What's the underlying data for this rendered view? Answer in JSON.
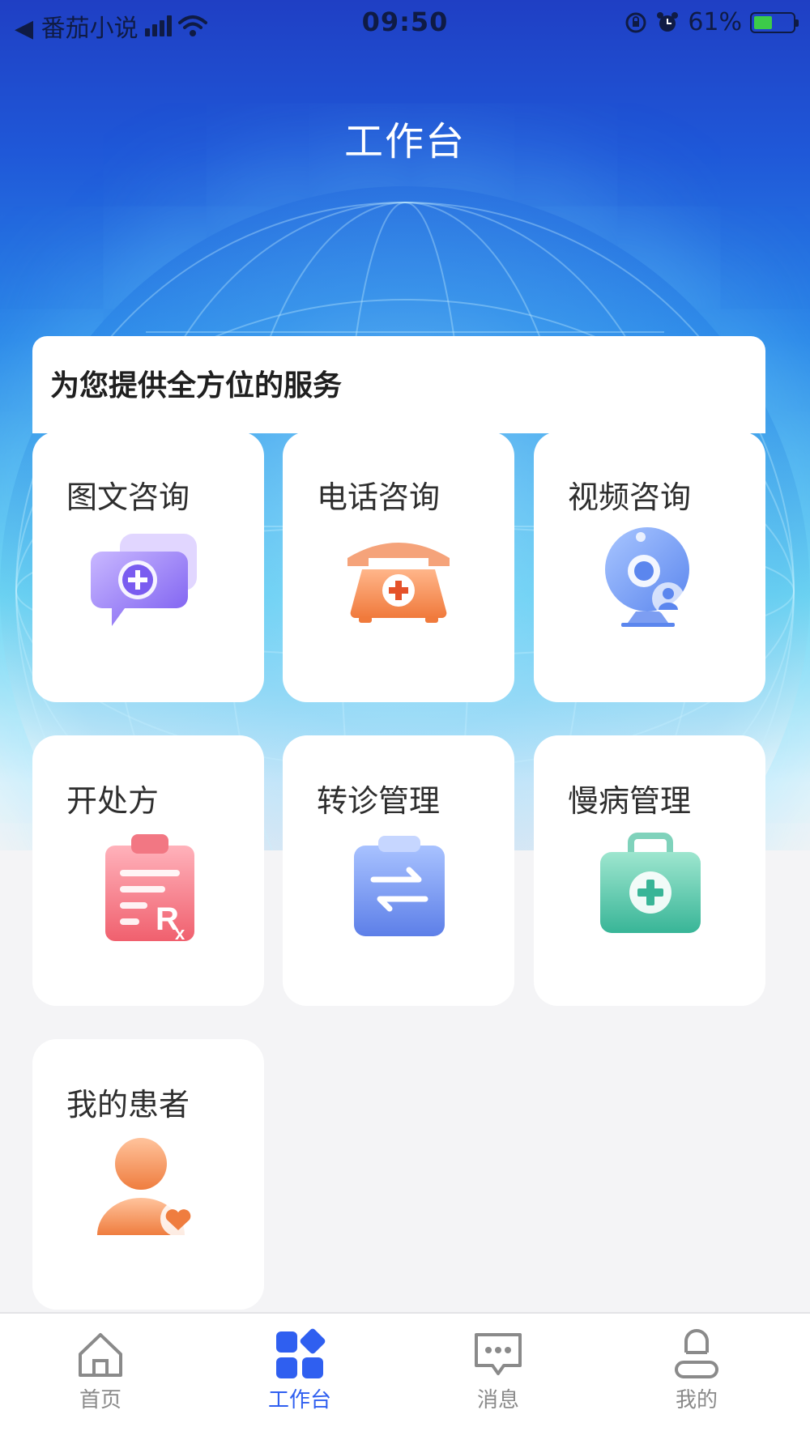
{
  "status_bar": {
    "back_app": "◀ 番茄小说",
    "time": "09:50",
    "battery_percent": "61%",
    "battery_level": 0.61
  },
  "page": {
    "title": "工作台"
  },
  "services": {
    "subtitle": "为您提供全方位的服务",
    "items": [
      {
        "label": "图文咨询",
        "icon": "chat-plus-icon"
      },
      {
        "label": "电话咨询",
        "icon": "telephone-icon"
      },
      {
        "label": "视频咨询",
        "icon": "webcam-icon"
      },
      {
        "label": "开处方",
        "icon": "prescription-icon"
      },
      {
        "label": "转诊管理",
        "icon": "transfer-clipboard-icon"
      },
      {
        "label": "慢病管理",
        "icon": "medical-kit-icon"
      },
      {
        "label": "我的患者",
        "icon": "patient-heart-icon"
      }
    ]
  },
  "tab_bar": {
    "items": [
      {
        "label": "首页",
        "icon": "home-icon",
        "active": false
      },
      {
        "label": "工作台",
        "icon": "workbench-icon",
        "active": true
      },
      {
        "label": "消息",
        "icon": "message-icon",
        "active": false
      },
      {
        "label": "我的",
        "icon": "profile-icon",
        "active": false
      }
    ],
    "active_color": "#2f5ff0",
    "inactive_color": "#8a8a8a"
  }
}
